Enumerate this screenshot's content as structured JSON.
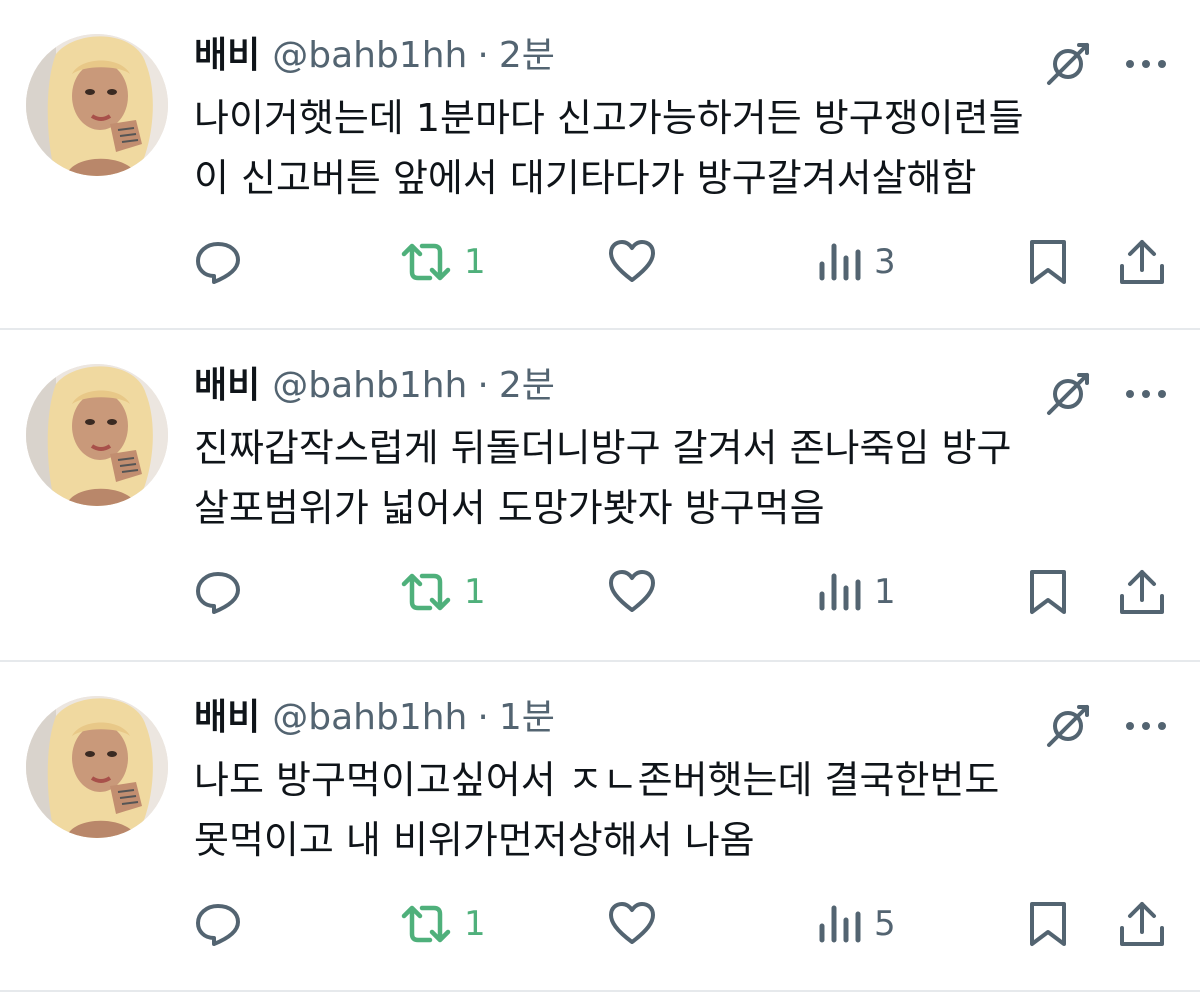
{
  "tweets": [
    {
      "display_name": "배비",
      "handle": "@bahb1hh",
      "separator": "·",
      "time": "2분",
      "text": "나이거햇는데 1분마다 신고가능하거든 방구쟁이련들\n이 신고버튼 앞에서 대기타다가 방구갈겨서살해함",
      "retweets": "1",
      "views": "3"
    },
    {
      "display_name": "배비",
      "handle": "@bahb1hh",
      "separator": "·",
      "time": "2분",
      "text": "진짜갑작스럽게 뒤돌더니방구 갈겨서 존나죽임 방구\n살포범위가 넓어서 도망가봣자 방구먹음",
      "retweets": "1",
      "views": "1"
    },
    {
      "display_name": "배비",
      "handle": "@bahb1hh",
      "separator": "·",
      "time": "1분",
      "text": "나도 방구먹이고싶어서 ㅈㄴ존버햇는데 결국한번도\n못먹이고 내 비위가먼저상해서 나옴",
      "retweets": "1",
      "views": "5"
    }
  ],
  "icons": {
    "reply": "speech-bubble-icon",
    "retweet": "retweet-icon",
    "like": "heart-icon",
    "views": "bar-chart-icon",
    "bookmark": "bookmark-icon",
    "share": "share-icon",
    "grok": "grok-icon",
    "more": "more-dots-icon"
  },
  "colors": {
    "text": "#0f1419",
    "secondary": "#536471",
    "retweet_active": "#4fb07b",
    "divider": "#e6e9ec"
  }
}
